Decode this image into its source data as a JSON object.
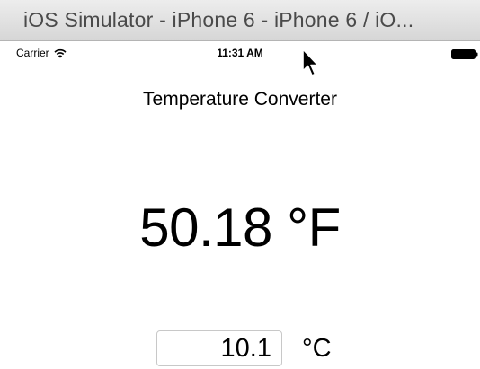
{
  "window": {
    "title": "iOS Simulator - iPhone 6 - iPhone 6 / iO..."
  },
  "status_bar": {
    "carrier": "Carrier",
    "time": "11:31 AM",
    "wifi_icon": "wifi-icon",
    "battery_icon": "battery-icon"
  },
  "app": {
    "title": "Temperature Converter",
    "result": "50.18 °F",
    "input_value": "10.1",
    "input_unit": "°C"
  },
  "colors": {
    "titlebar": "#dcdcdc",
    "caret": "#1e6bf0"
  }
}
